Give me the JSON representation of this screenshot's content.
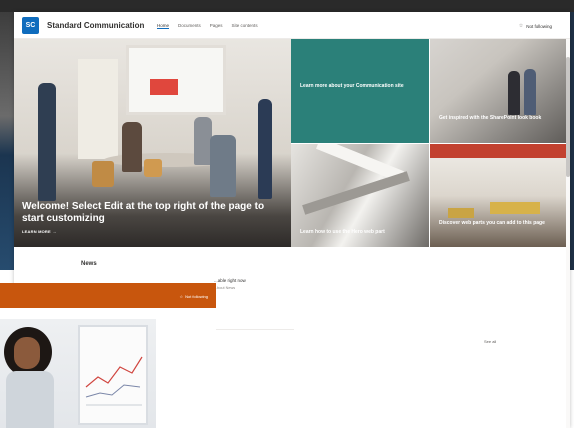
{
  "site": {
    "logo_initials": "SC",
    "title": "Standard Communication",
    "nav": [
      "Home",
      "Documents",
      "Pages",
      "Site contents"
    ],
    "follow_label": "Not following"
  },
  "hero": {
    "main_text": "Welcome! Select Edit at the top right of the page to start customizing",
    "main_link": "LEARN MORE →",
    "tiles": [
      "Learn more about your Communication site",
      "Get inspired with the SharePoint look book",
      "Learn how to use the Hero web part",
      "Discover web parts you can add to this page"
    ]
  },
  "news": {
    "title": "News",
    "headline": "...able right now",
    "sub": "...bout News",
    "see_all": "See all"
  },
  "second_window": {
    "follow_label": "Not following"
  },
  "colors": {
    "accent": "#0f6cbd",
    "tile_teal": "#2b8079",
    "orange_bar": "#c8560d"
  }
}
